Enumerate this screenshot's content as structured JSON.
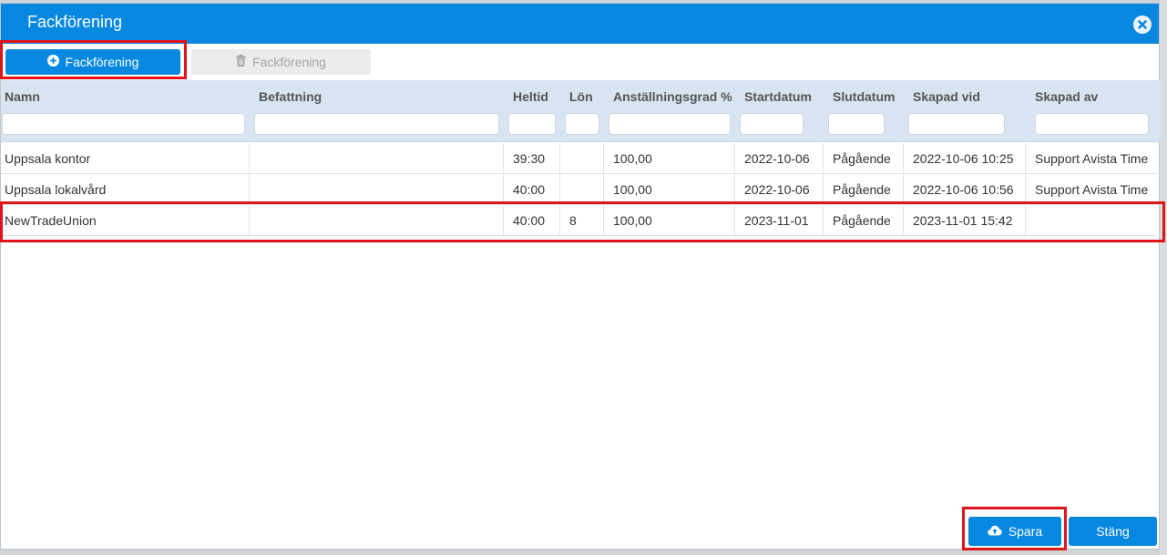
{
  "dialog": {
    "title": "Fackförening"
  },
  "toolbar": {
    "add_label": "Fackförening",
    "delete_label": "Fackförening"
  },
  "columns": [
    {
      "key": "namn",
      "label": "Namn"
    },
    {
      "key": "befattning",
      "label": "Befattning"
    },
    {
      "key": "heltid",
      "label": "Heltid"
    },
    {
      "key": "lon",
      "label": "Lön"
    },
    {
      "key": "grad",
      "label": "Anställningsgrad %"
    },
    {
      "key": "start",
      "label": "Startdatum"
    },
    {
      "key": "slut",
      "label": "Slutdatum"
    },
    {
      "key": "skapad_vid",
      "label": "Skapad vid"
    },
    {
      "key": "skapad_av",
      "label": "Skapad av"
    }
  ],
  "rows": [
    {
      "namn": "Uppsala kontor",
      "befattning": "",
      "heltid": "39:30",
      "lon": "",
      "grad": "100,00",
      "start": "2022-10-06",
      "slut": "Pågående",
      "skapad_vid": "2022-10-06 10:25",
      "skapad_av": "Support Avista Time"
    },
    {
      "namn": "Uppsala lokalvård",
      "befattning": "",
      "heltid": "40:00",
      "lon": "",
      "grad": "100,00",
      "start": "2022-10-06",
      "slut": "Pågående",
      "skapad_vid": "2022-10-06 10:56",
      "skapad_av": "Support Avista Time"
    },
    {
      "namn": "NewTradeUnion",
      "befattning": "",
      "heltid": "40:00",
      "lon": "8",
      "grad": "100,00",
      "start": "2023-11-01",
      "slut": "Pågående",
      "skapad_vid": "2023-11-01 15:42",
      "skapad_av": ""
    }
  ],
  "footer": {
    "save_label": "Spara",
    "close_label": "Stäng"
  },
  "colors": {
    "accent": "#0788e0",
    "highlight": "#e0141b",
    "grid_header": "#d6e5f1"
  }
}
